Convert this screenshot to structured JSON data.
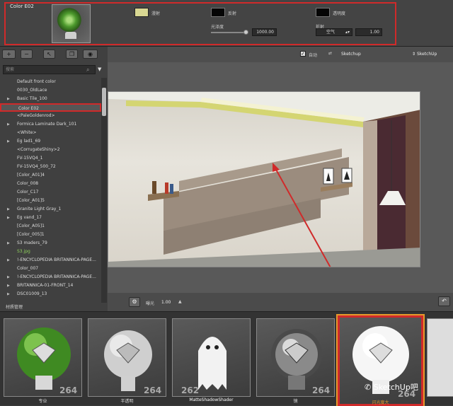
{
  "material_props": {
    "title": "Color E02",
    "diffuse_label": "漫射",
    "diffuse_color": "#d9d893",
    "reflect_label": "反射",
    "reflect_color": "#050505",
    "opacity_label": "透明度",
    "opacity_color": "#050505",
    "gloss_label": "光泽度",
    "gloss_value": "1000.00",
    "refract_label": "折射",
    "refract_preset": "空气",
    "refract_value": "1.00"
  },
  "toolbar": {
    "add_label": "+",
    "remove_label": "−"
  },
  "search": {
    "placeholder": "搜索"
  },
  "material_list": [
    {
      "label": "Default front color",
      "expandable": false
    },
    {
      "label": "0030_OldLace",
      "expandable": false
    },
    {
      "label": "Basic Tile_100",
      "expandable": true
    },
    {
      "label": "Color E02",
      "expandable": false,
      "selected": true
    },
    {
      "label": "<PaleGoldenrod>",
      "expandable": false
    },
    {
      "label": "Formica Laminate Dark_101",
      "expandable": true
    },
    {
      "label": "<White>",
      "expandable": false
    },
    {
      "label": "Eg lad1_69",
      "expandable": true
    },
    {
      "label": "<CorrugateShiny>2",
      "expandable": false
    },
    {
      "label": "FV-15VQ4_1",
      "expandable": false
    },
    {
      "label": "FV-15VQ4_500_72",
      "expandable": false
    },
    {
      "label": "[Color_A01]4",
      "expandable": false
    },
    {
      "label": "Color_008",
      "expandable": false
    },
    {
      "label": "Color_C17",
      "expandable": false
    },
    {
      "label": "[Color_A01]5",
      "expandable": false
    },
    {
      "label": "Granite Light Gray_1",
      "expandable": true
    },
    {
      "label": "Eg vand_17",
      "expandable": true
    },
    {
      "label": "[Color_A05]1",
      "expandable": false
    },
    {
      "label": "[Color_005]1",
      "expandable": false
    },
    {
      "label": "S3 maders_79",
      "expandable": true
    },
    {
      "label": "S3.jpg",
      "expandable": false,
      "green": true
    },
    {
      "label": "!-ENCYCLOPEDIA BRITANNICA-PAGE...",
      "expandable": true
    },
    {
      "label": "Color_007",
      "expandable": false
    },
    {
      "label": "!-ENCYCLOPEDIA BRITANNICA-PAGE...",
      "expandable": true
    },
    {
      "label": "BRITANNICA-01-FRONT_14",
      "expandable": true
    },
    {
      "label": "DSC01009_13",
      "expandable": true
    }
  ],
  "left_status": "材质管理",
  "view_top": {
    "auto_label": "自动",
    "source_label": "Sketchup",
    "right_label": "SketchUp"
  },
  "view_bottom": {
    "exposure_label": "曝光",
    "exposure_value": "1.00"
  },
  "strip": [
    {
      "label": "专业"
    },
    {
      "label": "半透明"
    },
    {
      "label": "MatteShadowShader"
    },
    {
      "label": "镜"
    },
    {
      "label": "闪光度大"
    }
  ],
  "watermark": "SketchUp吧",
  "colors": {
    "highlight_red": "#d02a2a",
    "selection_orange": "#e59a2c"
  }
}
